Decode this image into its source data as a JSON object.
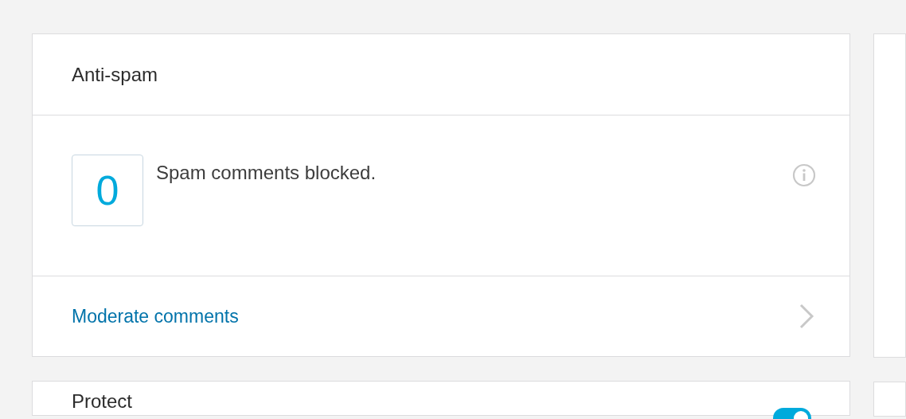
{
  "cards": [
    {
      "title": "Anti-spam",
      "stat": {
        "value": "0",
        "label": "Spam comments blocked."
      },
      "link": "Moderate comments"
    }
  ],
  "next_card": {
    "title": "Protect",
    "toggle": {
      "on": true
    }
  }
}
